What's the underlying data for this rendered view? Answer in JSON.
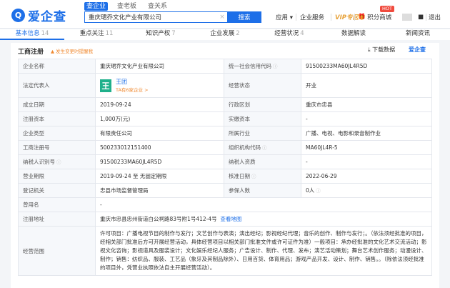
{
  "header": {
    "logo_mark": "Q",
    "logo_text": "爱企查",
    "search_tabs": [
      "查企业",
      "查老板",
      "查关系"
    ],
    "search_value": "重庆珺乔文化产业有限公司",
    "search_button": "搜索",
    "nav": {
      "apply": "应用 ▾",
      "enterprise": "企业服务",
      "vip": "VIP专区",
      "points": "积分商城",
      "hot": "HOT",
      "logout": "退出"
    }
  },
  "tabs": [
    {
      "label": "基本信息",
      "count": "14"
    },
    {
      "label": "重点关注",
      "count": "11"
    },
    {
      "label": "知识产权",
      "count": "7"
    },
    {
      "label": "企业发展",
      "count": "2"
    },
    {
      "label": "经营状况",
      "count": "4"
    },
    {
      "label": "数据解读",
      "count": ""
    },
    {
      "label": "新闻资讯",
      "count": ""
    }
  ],
  "section": {
    "title": "工商注册",
    "note": "▲ 发生变更时提醒我",
    "download": "下载数据",
    "brand": "爱企查"
  },
  "registration": {
    "company_name_label": "企业名称",
    "company_name": "重庆珺乔文化产业有限公司",
    "credit_code_label": "统一社会信用代码",
    "credit_code": "91500233MA60JL4R5D",
    "legal_rep_label": "法定代表人",
    "legal_rep_initial": "王",
    "legal_rep_name": "王团",
    "legal_rep_sub": "TA有6家企业 >",
    "status_label": "经营状态",
    "status": "开业",
    "founded_label": "成立日期",
    "founded": "2019-09-24",
    "district_label": "行政区划",
    "district": "重庆市忠县",
    "capital_label": "注册资本",
    "capital": "1,000万(元)",
    "paid_capital_label": "实缴资本",
    "paid_capital": "-",
    "type_label": "企业类型",
    "type": "有限责任公司",
    "industry_label": "所属行业",
    "industry": "广播、电视、电影和录音制作业",
    "reg_no_label": "工商注册号",
    "reg_no": "500233012151400",
    "org_code_label": "组织机构代码",
    "org_code": "MA60JL4R-5",
    "tax_id_label": "纳税人识别号",
    "tax_id": "91500233MA60JL4R5D",
    "tax_qual_label": "纳税人资质",
    "tax_qual": "-",
    "term_label": "营业期限",
    "term": "2019-09-24 至 无固定期限",
    "approval_label": "核准日期",
    "approval": "2022-06-29",
    "authority_label": "登记机关",
    "authority": "忠县市场监督管理局",
    "insured_label": "参保人数",
    "insured": "0人",
    "former_name_label": "曾用名",
    "former_name": "-",
    "address_label": "注册地址",
    "address": "重庆市忠县忠州街道白公祠路83号附1号412-4号",
    "map_link": "查看地图",
    "scope_label": "经营范围",
    "scope": "许可项目：广播电视节目的制作与发行；文艺创作与表演；演出经纪；影视经纪代理；音乐的创作、制作与发行；。（依法须经批准的项目，经相关部门批准后方可开展经营活动，具体经营项目以相关部门批准文件或许可证件为准）一般项目：承办经批准的文化艺术交流活动；影视文化咨询；影视道具及服装设计；文化娱乐经纪人服务；广告设计、制作、代理、发布；演艺活动策划；舞台艺术创作服务；动漫设计、制作；销售：纺织品、服装、工艺品（象牙及其制品除外）、日用百货、体育用品；游戏产品开发、设计、制作、销售。。（除依法须经批准的项目外，凭营业执照依法自主开展经营活动）。"
  }
}
